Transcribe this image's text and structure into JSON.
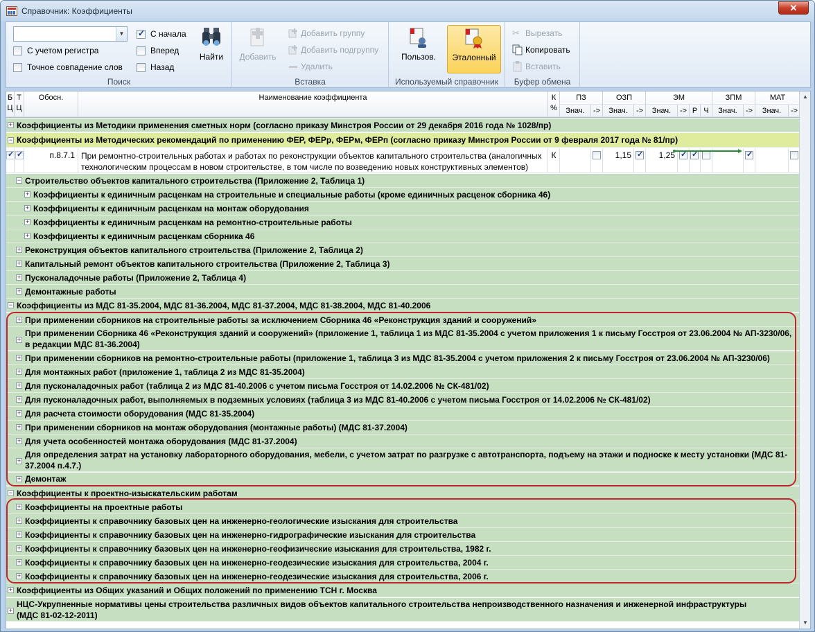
{
  "window": {
    "title": "Справочник: Коэффициенты",
    "close": "✕"
  },
  "ribbon": {
    "search": {
      "label": "Поиск",
      "combo_value": "",
      "case_label": "С учетом регистра",
      "case_checked": false,
      "exact_label": "Точное совпадение слов",
      "exact_checked": false,
      "from_start_label": "С начала",
      "from_start_checked": true,
      "forward_label": "Вперед",
      "forward_checked": false,
      "back_label": "Назад",
      "back_checked": false,
      "find_label": "Найти"
    },
    "insert": {
      "label": "Вставка",
      "add_label": "Добавить",
      "add_group_label": "Добавить группу",
      "add_subgroup_label": "Добавить подгруппу",
      "delete_label": "Удалить"
    },
    "used": {
      "label": "Используемый справочник",
      "user_label": "Пользов.",
      "reference_label": "Эталонный"
    },
    "clipboard": {
      "label": "Буфер обмена",
      "cut_label": "Вырезать",
      "copy_label": "Копировать",
      "paste_label": "Вставить"
    }
  },
  "grid": {
    "headers": {
      "bc": "Б\nЦ",
      "tc": "Т\nЦ",
      "basis": "Обосн.",
      "name": "Наименование коэффициента",
      "kp": "К\n%",
      "pz": "ПЗ",
      "ozp": "ОЗП",
      "em": "ЭМ",
      "zpm": "ЗПМ",
      "mat": "МАТ",
      "val": "Знач.",
      "arrow": "->",
      "r": "Р",
      "ch": "Ч"
    },
    "data_row": {
      "basis": "п.8.7.1",
      "name": "При ремонтно-строительных работах и работах по реконструкции объектов капитального строительства (аналогичных технологическим процессам в новом строительстве, в том числе по возведению новых конструктивных элементов)",
      "kp": "К",
      "ozp_value": "1,15",
      "em_value": "1,25"
    },
    "rows": [
      "Коэффициенты из Методики применения сметных норм (согласно приказу Минстроя России от 29 декабря 2016 года № 1028/пр)",
      "Коэффициенты из Методических рекомендаций по применению ФЕР, ФЕРр, ФЕРм, ФЕРп (согласно приказу Минстроя России от 9 февраля 2017 года № 81/пр)",
      "Строительство объектов капитального строительства (Приложение 2, Таблица 1)",
      "Коэффициенты к единичным расценкам на строительные и специальные работы (кроме единичных расценок сборника 46)",
      "Коэффициенты к единичным расценкам на монтаж оборудования",
      "Коэффициенты к единичным расценкам на ремонтно-строительные работы",
      "Коэффициенты к единичным расценкам сборника 46",
      "Реконструкция объектов капитального строительства (Приложение 2, Таблица 2)",
      "Капитальный ремонт объектов капитального строительства (Приложение 2, Таблица 3)",
      "Пусконаладочные работы (Приложение 2, Таблица 4)",
      "Демонтажные работы",
      "Коэффициенты из МДС 81-35.2004, МДС 81-36.2004, МДС 81-37.2004, МДС 81-38.2004, МДС 81-40.2006",
      "При применении сборников на строительные работы за исключением Сборника 46 «Реконструкция зданий и сооружений»",
      "При применении Сборника 46 «Реконструкция зданий и сооружений» (приложение 1, таблица 1 из МДС 81-35.2004 с учетом приложения 1 к письму Госстроя от 23.06.2004 № АП-3230/06, в редакции МДС 81-36.2004)",
      "При применении сборников на ремонтно-строительные работы (приложение 1, таблица 3 из МДС 81-35.2004 с учетом приложения 2 к письму Госстроя от 23.06.2004 № АП-3230/06)",
      "Для монтажных работ (приложение 1, таблица 2 из МДС 81-35.2004)",
      "Для пусконаладочных работ (таблица 2 из МДС 81-40.2006 с учетом письма Госстроя от 14.02.2006 № СК-481/02)",
      "Для пусконаладочных работ, выполняемых в подземных условиях (таблица 3 из МДС 81-40.2006 с учетом письма Госстроя от 14.02.2006 № СК-481/02)",
      "Для расчета стоимости оборудования (МДС 81-35.2004)",
      "При применении сборников на монтаж оборудования (монтажные работы) (МДС 81-37.2004)",
      "Для учета особенностей монтажа оборудования (МДС 81-37.2004)",
      "Для определения затрат на установку лабораторного оборудования, мебели, с учетом затрат по разгрузке с автотранспорта, подъему на этажи и подноске к месту установки (МДС 81-37.2004 п.4.7.)",
      "Демонтаж",
      "Коэффициенты к проектно-изыскательским работам",
      "Коэффициенты на проектные работы",
      "Коэффициенты к справочнику базовых цен на инженерно-геологические изыскания для строительства",
      "Коэффициенты к справочнику базовых цен на инженерно-гидрографические изыскания для строительства",
      "Коэффициенты к справочнику базовых цен на инженерно-геофизические изыскания для строительства, 1982 г.",
      "Коэффициенты к справочнику базовых цен на инженерно-геодезические изыскания для строительства, 2004 г.",
      "Коэффициенты к справочнику базовых цен на инженерно-геодезические изыскания для строительства, 2006 г.",
      "Коэффициенты из Общих указаний и Общих положений по применению ТСН г. Москва",
      "НЦС-Укрупненные нормативы цены строительства различных видов объектов капитального строительства непроизводственного назначения и инженерной инфраструктуры (МДС 81-02-12-2011)"
    ],
    "expander_plus": "+",
    "expander_minus": "−"
  }
}
